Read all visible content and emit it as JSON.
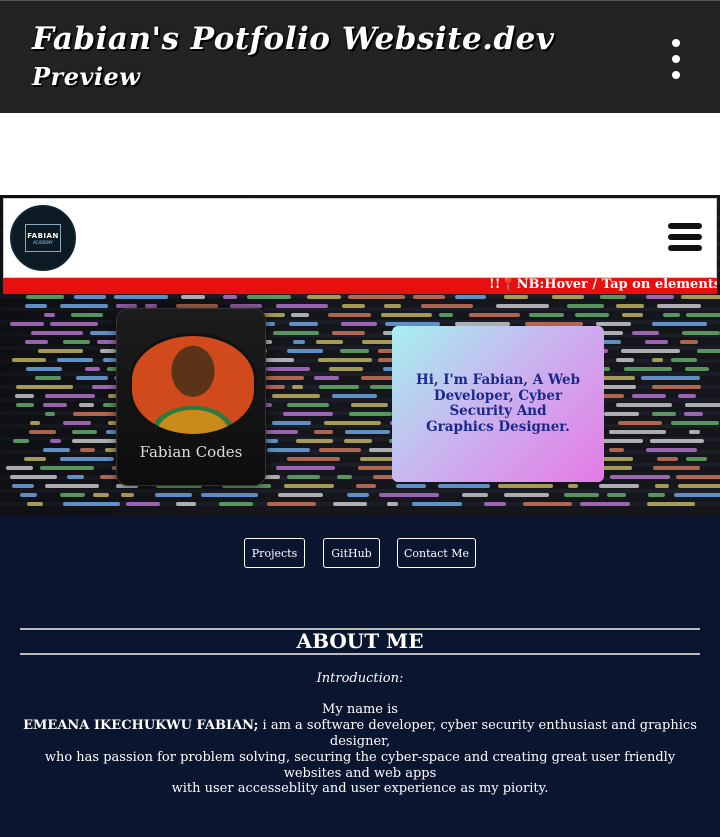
{
  "app_header": {
    "title_line1": "Fabian's Potfolio Website.dev",
    "title_line2": "Preview",
    "menu_icon": "more-vertical-icon"
  },
  "site_nav": {
    "logo_text": "FABIAN",
    "logo_subtext": "ACADEMY",
    "menu_icon": "hamburger-menu-icon"
  },
  "marquee": {
    "text": "!!📍NB:Hover / Tap on elements(i"
  },
  "profile_card": {
    "name": "Fabian Codes"
  },
  "intro_card": {
    "text": "Hi, I'm Fabian, A Web Developer, Cyber Security And Graphics Designer."
  },
  "buttons": {
    "projects": "Projects",
    "github": "GitHub",
    "contact": "Contact Me"
  },
  "about": {
    "title": "ABOUT ME",
    "intro_label": "Introduction:",
    "line1": "My name is",
    "name_bold": "EMEANA IKECHUKWU FABIAN;",
    "line2_rest": " i am a software developer, cyber security enthusiast and graphics designer,",
    "line3": "who has passion for problem solving, securing the cyber-space and creating great user friendly websites and web apps",
    "line4": "with user accesseblity and user experience as my piority."
  },
  "colors": {
    "app_bar": "#232323",
    "page_bg": "#0a1530",
    "marquee_bg": "#e8100f",
    "intro_text": "#1b2a8a"
  }
}
